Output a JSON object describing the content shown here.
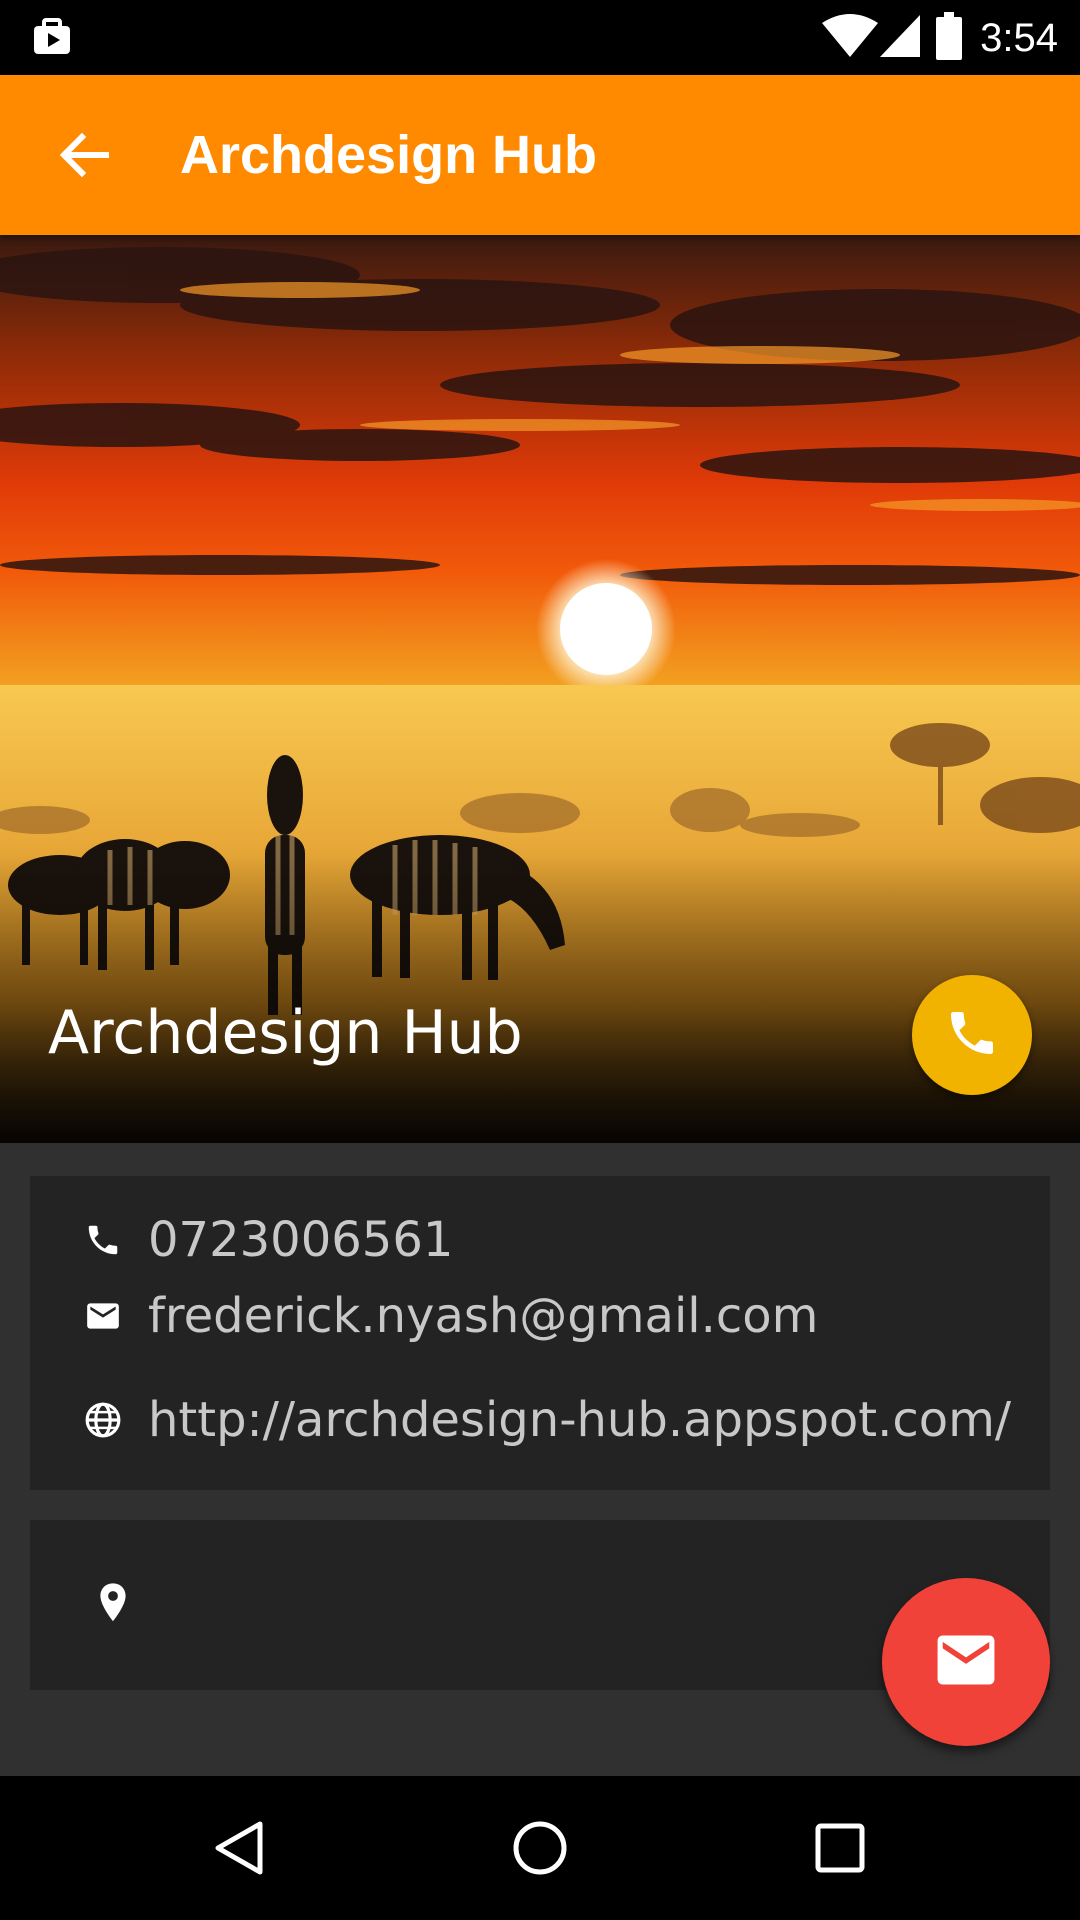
{
  "status_bar": {
    "time": "3:54",
    "icons": [
      "notification-bag-icon",
      "wifi-icon",
      "signal-icon",
      "battery-icon"
    ]
  },
  "toolbar": {
    "title": "Archdesign Hub",
    "back_icon": "arrow-back-icon",
    "color": "#FF8A00"
  },
  "hero": {
    "title": "Archdesign Hub",
    "image": "sunset-savanna-zebras"
  },
  "contact": {
    "phone": "0723006561",
    "email": "frederick.nyash@gmail.com",
    "website": "http://archdesign-hub.appspot.com/"
  },
  "address": {
    "text": ""
  },
  "actions": {
    "call_fab_color": "#F2B200",
    "mail_fab_color": "#F1423A"
  },
  "nav_bar": {
    "buttons": [
      "back-icon",
      "home-icon",
      "recents-icon"
    ]
  }
}
